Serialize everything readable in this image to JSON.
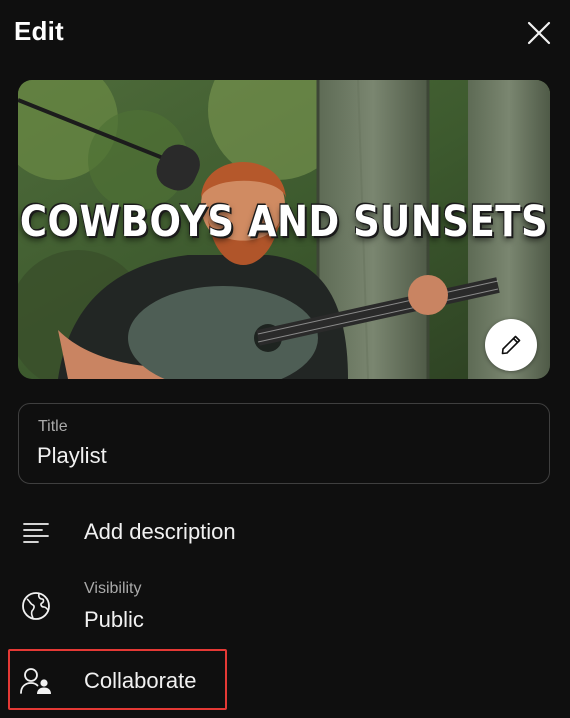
{
  "header": {
    "title": "Edit"
  },
  "thumbnail": {
    "overlay_text": "COWBOYS AND SUNSETS"
  },
  "title_field": {
    "label": "Title",
    "value": "Playlist"
  },
  "menu": {
    "description_label": "Add description",
    "visibility_label": "Visibility",
    "visibility_value": "Public",
    "collaborate_label": "Collaborate"
  },
  "icons": {
    "close": "close-icon",
    "pencil": "pencil-icon",
    "description": "description-lines-icon",
    "visibility": "globe-icon",
    "collaborate": "add-person-icon"
  },
  "colors": {
    "background": "#0f0f0f",
    "highlight": "#e53935",
    "text": "#f1f1f1",
    "secondary_text": "#aaaaaa"
  }
}
